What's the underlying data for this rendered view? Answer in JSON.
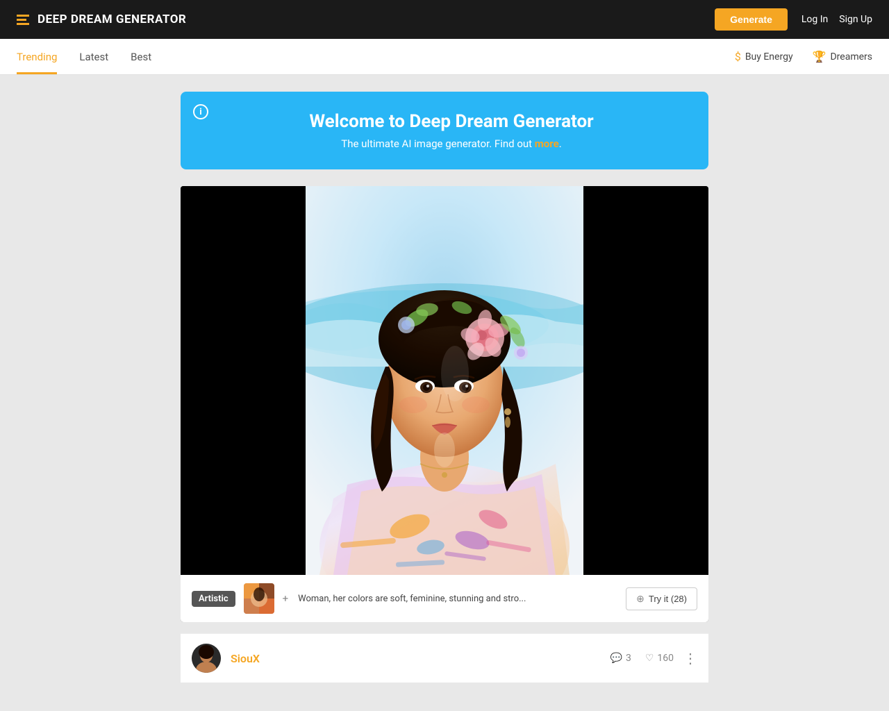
{
  "header": {
    "logo_text": "DEEP DREAM GENERATOR",
    "generate_label": "Generate",
    "login_label": "Log In",
    "signup_label": "Sign Up"
  },
  "nav": {
    "items": [
      {
        "label": "Trending",
        "active": true
      },
      {
        "label": "Latest",
        "active": false
      },
      {
        "label": "Best",
        "active": false
      }
    ],
    "right_items": [
      {
        "label": "Buy Energy",
        "icon": "$",
        "type": "energy"
      },
      {
        "label": "Dreamers",
        "icon": "🏆",
        "type": "dreamers"
      }
    ]
  },
  "banner": {
    "title": "Welcome to Deep Dream Generator",
    "description": "The ultimate AI image generator. Find out ",
    "link_text": "more",
    "link_suffix": "."
  },
  "image": {
    "tag": "Artistic",
    "prompt": "Woman, her colors are soft, feminine, stunning and stro...",
    "try_label": "Try it (28)"
  },
  "user": {
    "name": "SiouX",
    "comments": "3",
    "likes": "160"
  }
}
